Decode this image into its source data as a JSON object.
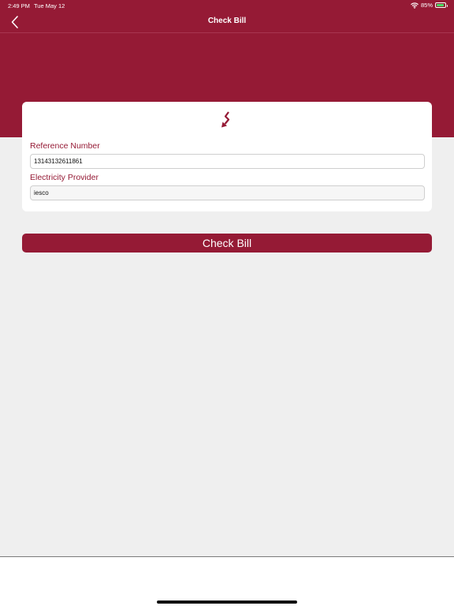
{
  "status_bar": {
    "time": "2:49 PM",
    "date": "Tue May 12",
    "battery_percent": "85%",
    "battery_level": 0.85,
    "icons": [
      "wifi-icon",
      "battery-icon"
    ]
  },
  "nav": {
    "title": "Check Bill",
    "back_icon": "chevron-left-icon"
  },
  "form": {
    "header_icon": "lightning-bolt-icon",
    "reference_label": "Reference Number",
    "reference_value": "13143132611861",
    "provider_label": "Electricity Provider",
    "provider_value": "iesco"
  },
  "actions": {
    "check_bill_label": "Check Bill"
  },
  "colors": {
    "brand": "#951a35",
    "background": "#efefef",
    "card": "#ffffff",
    "battery": "#4cd964"
  }
}
